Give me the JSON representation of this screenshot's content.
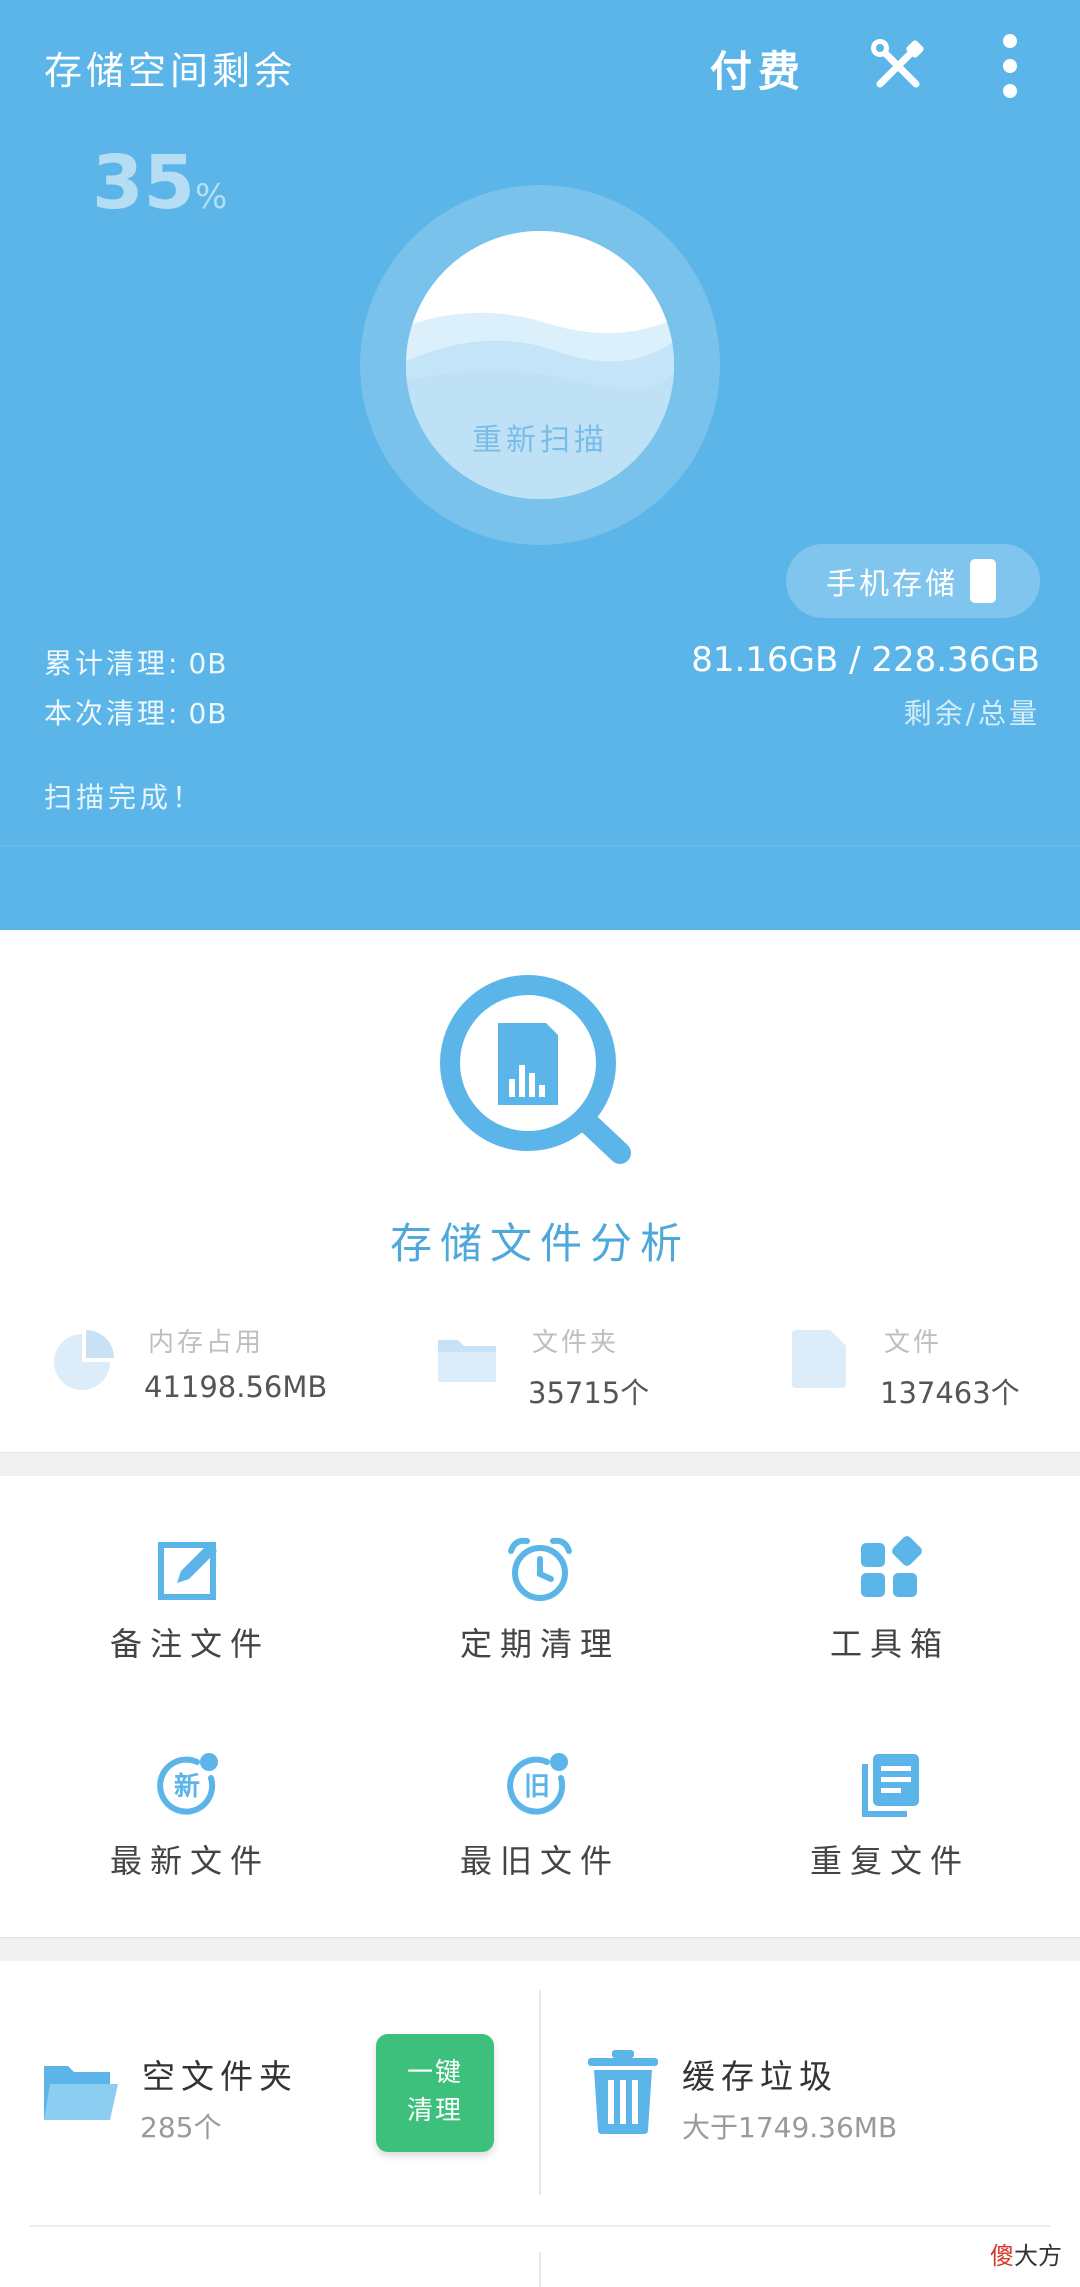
{
  "header": {
    "title": "存储空间剩余",
    "pay_label": "付费",
    "percent": "35",
    "percent_unit": "%",
    "rescan_label": "重新扫描",
    "phone_storage_label": "手机存储",
    "total_cleaned_label": "累计清理:",
    "total_cleaned_value": "0B",
    "this_cleaned_label": "本次清理:",
    "this_cleaned_value": "0B",
    "storage_value": "81.16GB / 228.36GB",
    "storage_caption": "剩余/总量",
    "scan_status": "扫描完成！",
    "icons": [
      "tools-icon",
      "more-icon",
      "phone-icon"
    ]
  },
  "analysis": {
    "title": "存储文件分析",
    "stats": [
      {
        "label": "内存占用",
        "value": "41198.56MB",
        "icon": "pie-chart-icon"
      },
      {
        "label": "文件夹",
        "value": "35715个",
        "icon": "folder-icon"
      },
      {
        "label": "文件",
        "value": "137463个",
        "icon": "file-icon"
      }
    ]
  },
  "grid": [
    {
      "label": "备注文件",
      "icon": "edit-icon"
    },
    {
      "label": "定期清理",
      "icon": "alarm-clock-icon"
    },
    {
      "label": "工具箱",
      "icon": "toolbox-icon"
    },
    {
      "label": "最新文件",
      "icon": "new-file-icon",
      "badge": "新"
    },
    {
      "label": "最旧文件",
      "icon": "old-file-icon",
      "badge": "旧"
    },
    {
      "label": "重复文件",
      "icon": "duplicate-file-icon"
    }
  ],
  "bottom": {
    "empty_folder": {
      "title": "空文件夹",
      "count": "285个",
      "button_line1": "一键",
      "button_line2": "清理"
    },
    "cache_junk": {
      "title": "缓存垃圾",
      "size": "大于1749.36MB"
    }
  },
  "watermark": {
    "red": "傻",
    "rest": "大方"
  },
  "colors": {
    "header_blue": "#5bb5e8",
    "accent_blue": "#4ea8dc",
    "clean_button_green": "#3cc07c"
  }
}
